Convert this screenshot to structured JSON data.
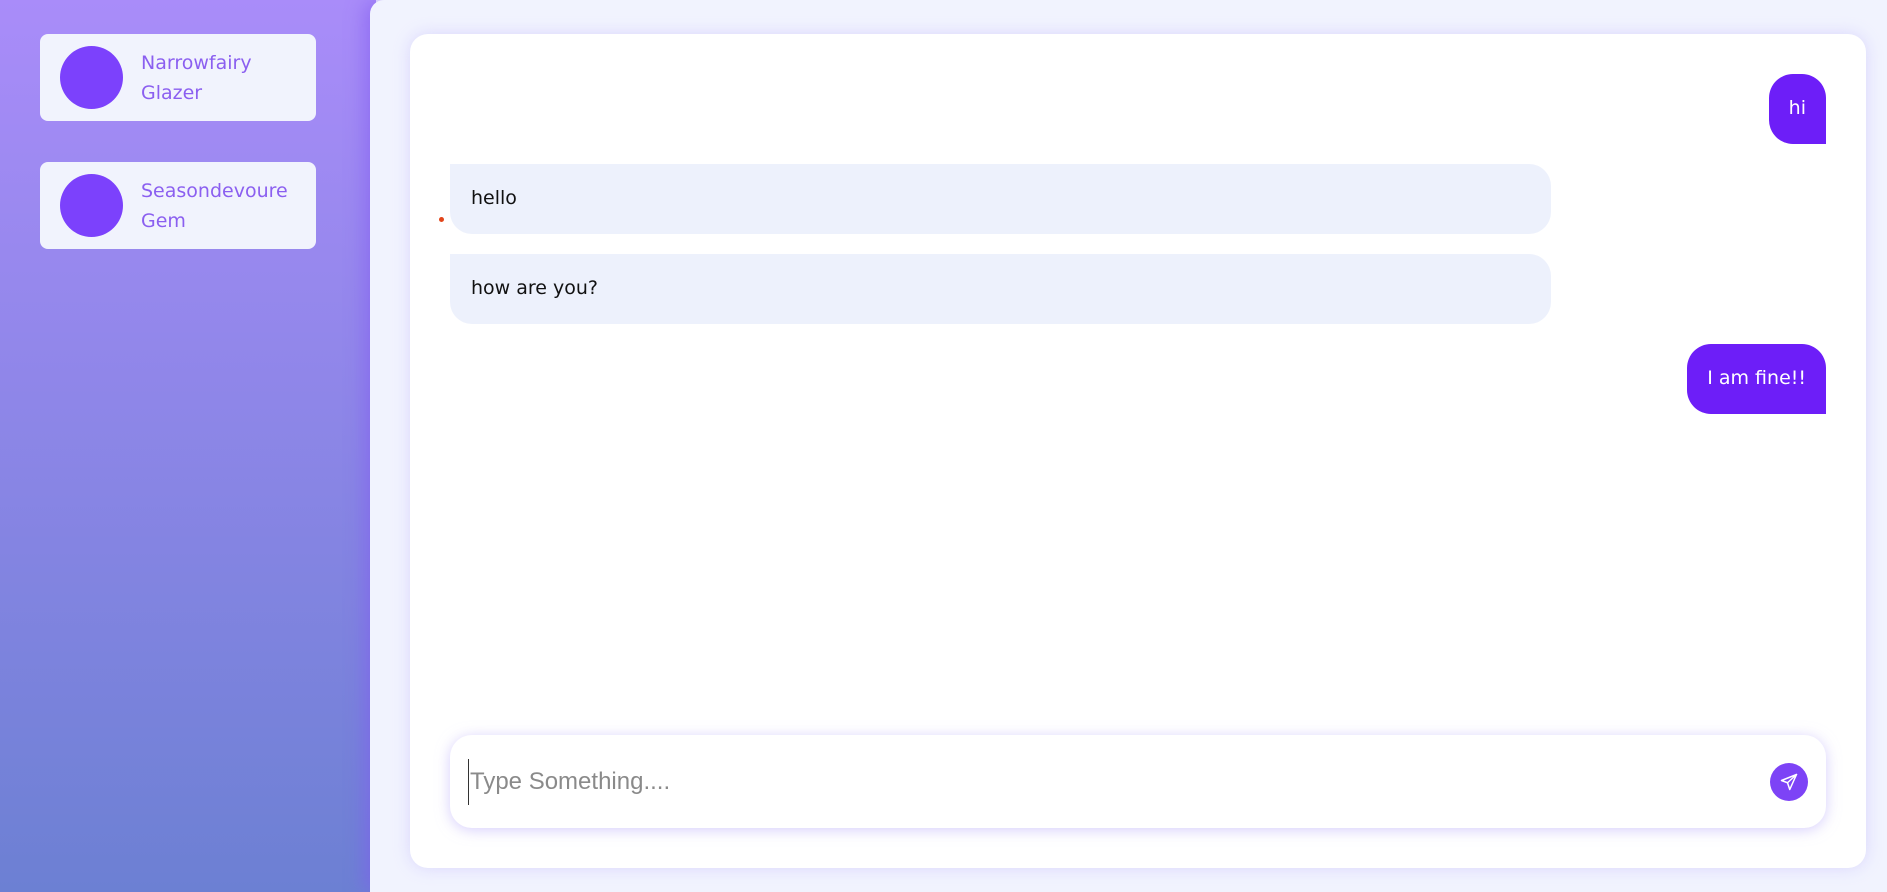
{
  "sidebar": {
    "contacts": [
      {
        "name": "Narrowfairy Glazer"
      },
      {
        "name": "Seasondevoure Gem"
      }
    ]
  },
  "chat": {
    "messages": [
      {
        "direction": "outgoing",
        "text": "hi"
      },
      {
        "direction": "incoming",
        "text": "hello"
      },
      {
        "direction": "incoming",
        "text": "how are you?"
      },
      {
        "direction": "outgoing",
        "text": "I am fine!!"
      }
    ]
  },
  "composer": {
    "placeholder": "Type Something....",
    "value": "",
    "send_icon": "paper-plane-icon"
  },
  "colors": {
    "accent": "#6d1ef8",
    "avatar": "#7c41fc",
    "incoming_bubble": "#edf1fc",
    "contact_name": "#8b5ff0"
  }
}
